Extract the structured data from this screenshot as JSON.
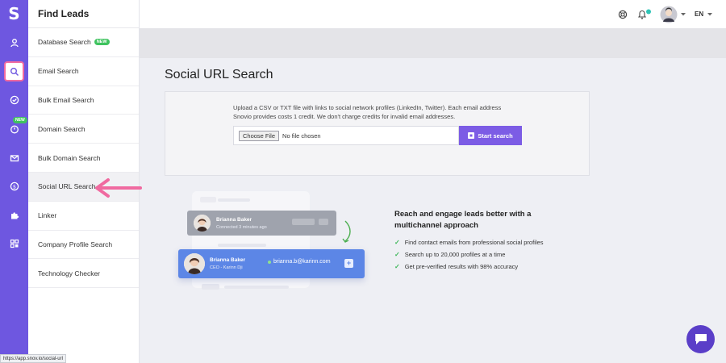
{
  "brand": {
    "logo_letter": "S"
  },
  "rail": {
    "items": [
      {
        "icon": "user-icon"
      },
      {
        "icon": "search-icon",
        "active": true
      },
      {
        "icon": "check-circle-icon"
      },
      {
        "icon": "drip-icon",
        "badge": "NEW"
      },
      {
        "icon": "mail-icon"
      },
      {
        "icon": "dollar-icon"
      },
      {
        "icon": "puzzle-icon"
      },
      {
        "icon": "grid-icon"
      }
    ]
  },
  "sidebar": {
    "title": "Find Leads",
    "items": [
      {
        "label": "Database Search",
        "badge": "NEW"
      },
      {
        "label": "Email Search"
      },
      {
        "label": "Bulk Email Search"
      },
      {
        "label": "Domain Search"
      },
      {
        "label": "Bulk Domain Search"
      },
      {
        "label": "Social URL Search",
        "active": true
      },
      {
        "label": "Linker"
      },
      {
        "label": "Company Profile Search"
      },
      {
        "label": "Technology Checker"
      }
    ]
  },
  "topbar": {
    "language": "EN"
  },
  "main": {
    "title": "Social URL Search",
    "upload": {
      "description_line1": "Upload a CSV or TXT file with links to social network profiles (LinkedIn, Twitter). Each email address",
      "description_line2": "Snovio provides costs 1 credit. We don't charge credits for invalid email addresses.",
      "choose_file_label": "Choose File",
      "no_file_text": "No file chosen",
      "start_button": "Start search"
    },
    "illustration": {
      "card1_name": "Brianna Baker",
      "card1_sub": "Connected 3 minutes ago",
      "card2_name": "Brianna Baker",
      "card2_sub": "CEO - Karinn Dji",
      "card2_email": "brianna.b@karinn.com"
    },
    "benefits": {
      "title": "Reach and engage leads better with a multichannel approach",
      "items": [
        "Find contact emails from professional social profiles",
        "Search up to 20,000 profiles at a time",
        "Get pre-verified results with 98% accuracy"
      ]
    }
  },
  "status_url": "https://app.snov.io/social-url",
  "colors": {
    "accent": "#6e57e0",
    "button": "#7c5ce5",
    "check": "#3fb75a",
    "pointer_arrow": "#f06aa0"
  }
}
